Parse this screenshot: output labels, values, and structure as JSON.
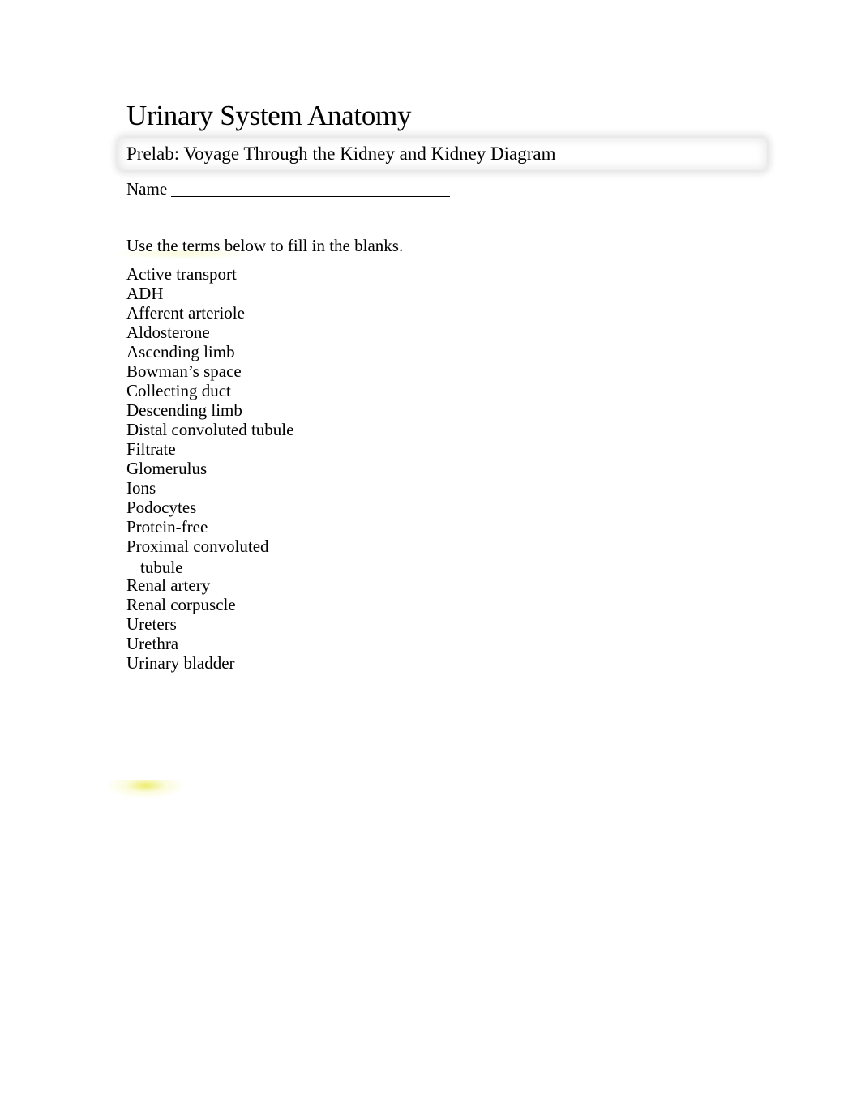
{
  "document": {
    "title": "Urinary System Anatomy",
    "subtitle": "Prelab: Voyage Through the Kidney and Kidney Diagram",
    "name_label": "Name",
    "instructions": "Use the terms below to fill in the blanks.",
    "terms": [
      {
        "text": "Active transport"
      },
      {
        "text": "ADH"
      },
      {
        "text": "Afferent arteriole"
      },
      {
        "text": "Aldosterone"
      },
      {
        "text": "Ascending limb"
      },
      {
        "text": "Bowman’s space"
      },
      {
        "text": "Collecting duct"
      },
      {
        "text": "Descending limb"
      },
      {
        "text": "Distal convoluted tubule"
      },
      {
        "text": "Filtrate"
      },
      {
        "text": "Glomerulus"
      },
      {
        "text": "Ions"
      },
      {
        "text": "Podocytes"
      },
      {
        "text": "Protein-free"
      },
      {
        "text": "Proximal convoluted",
        "continuation": "tubule"
      },
      {
        "text": "Renal artery"
      },
      {
        "text": "Renal corpuscle"
      },
      {
        "text": "Ureters"
      },
      {
        "text": "Urethra"
      },
      {
        "text": "Urinary bladder"
      }
    ]
  }
}
